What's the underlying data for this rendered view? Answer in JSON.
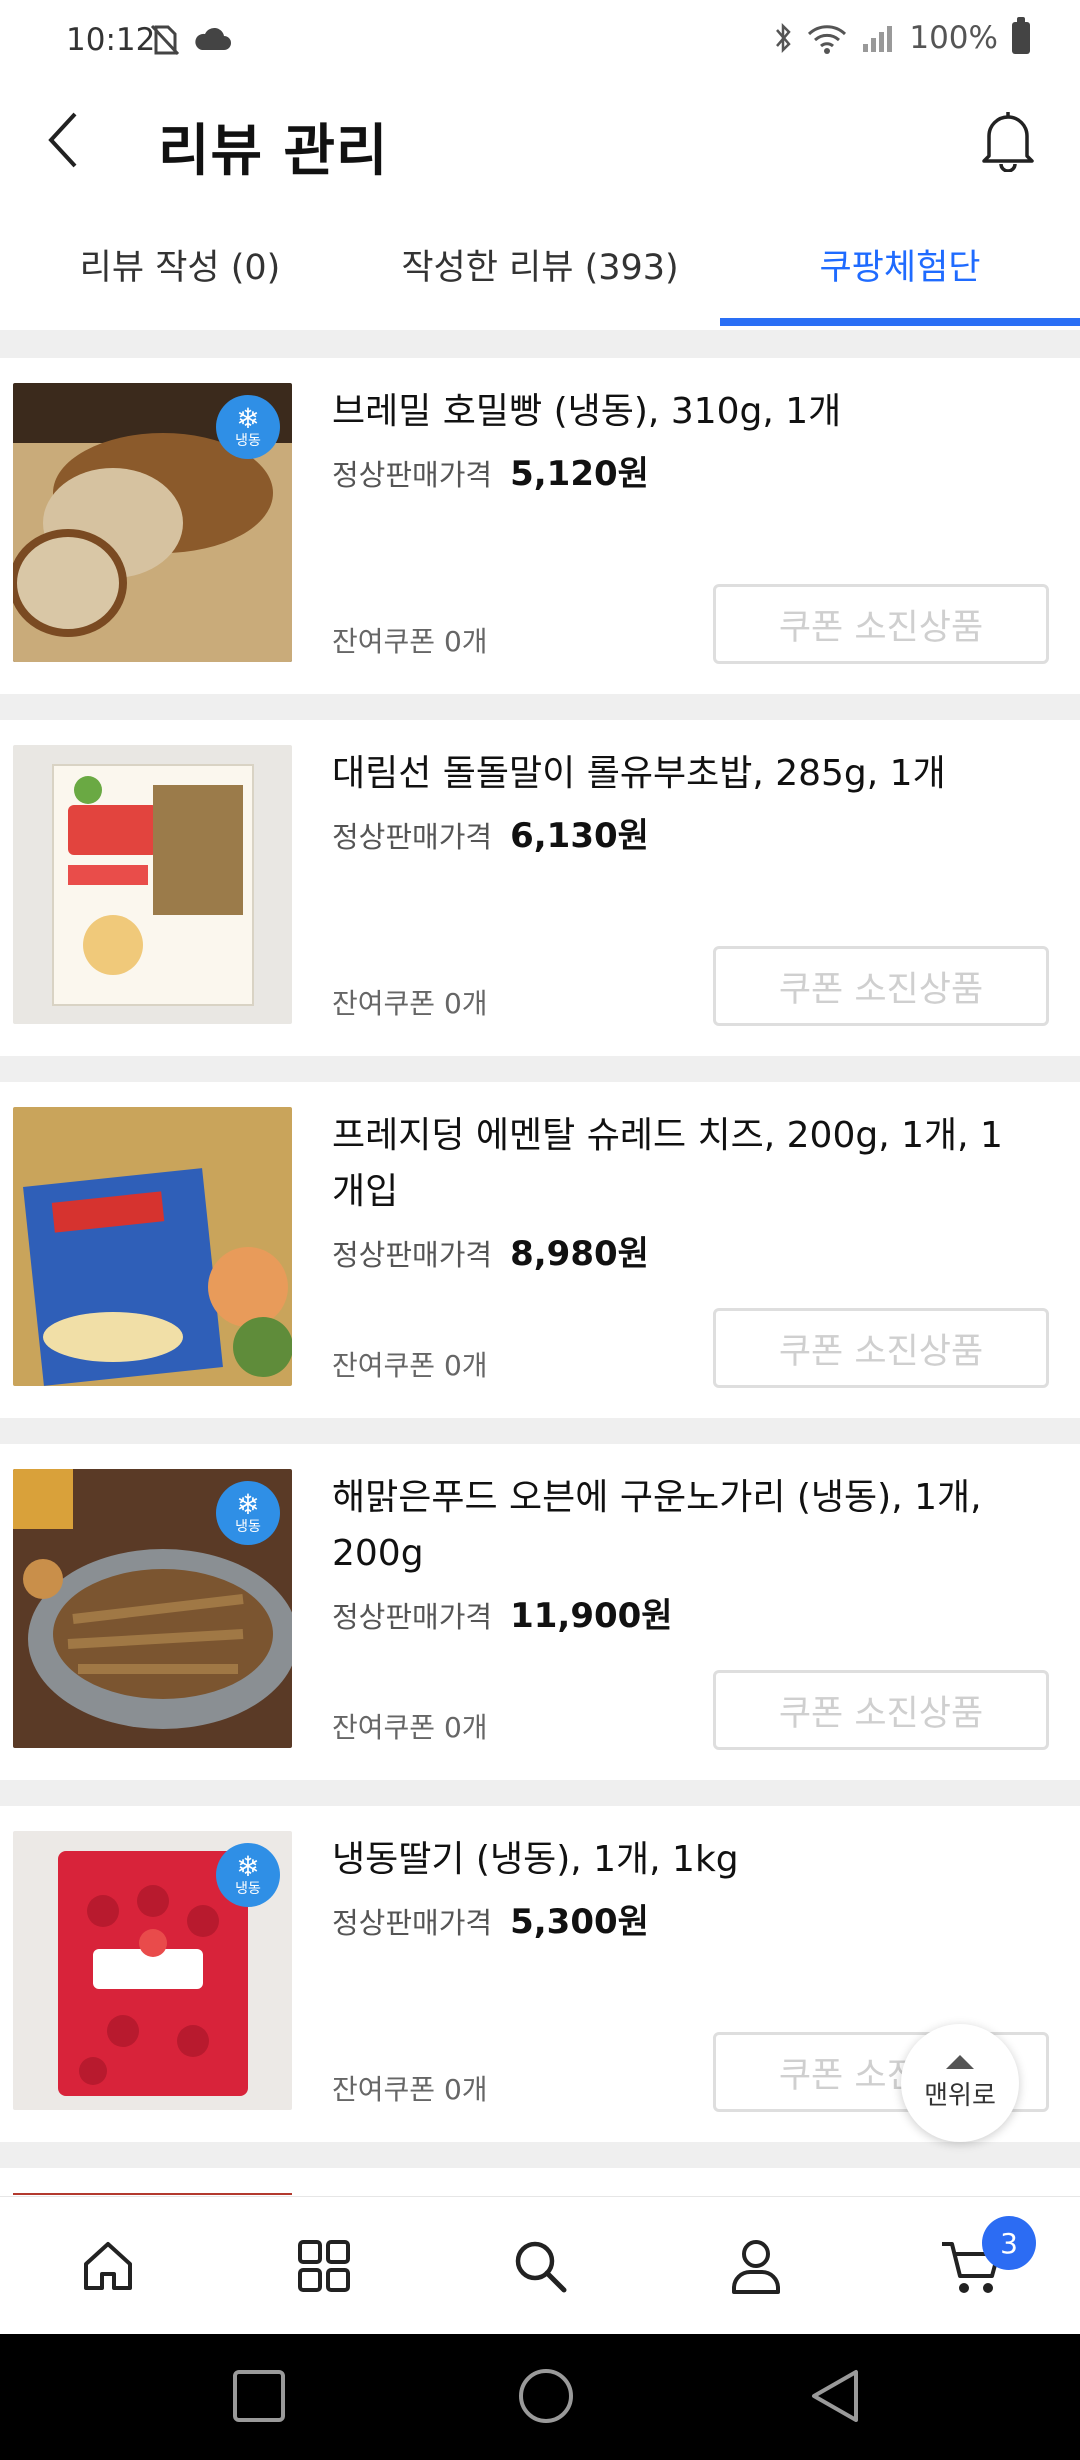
{
  "status_bar": {
    "time": "10:12",
    "battery": "100%",
    "left_icons": [
      "no-sim-icon",
      "cloud-icon"
    ],
    "right_icons": [
      "bluetooth-icon",
      "wifi-icon",
      "signal-icon",
      "battery-icon"
    ]
  },
  "header": {
    "title": "리뷰 관리",
    "back_icon": "chevron-left-icon",
    "bell_icon": "bell-icon"
  },
  "tabs": [
    {
      "label": "리뷰 작성 (0)",
      "active": false
    },
    {
      "label": "작성한 리뷰 (393)",
      "active": false
    },
    {
      "label": "쿠팡체험단",
      "active": true
    }
  ],
  "labels": {
    "price_label": "정상판매가격",
    "soldout_button": "쿠폰 소진상품",
    "frozen_badge": "냉동"
  },
  "items": [
    {
      "title": "브레밀 호밀빵 (냉동), 310g, 1개",
      "price": "5,120원",
      "remaining": "잔여쿠폰 0개",
      "frozen": true,
      "image": "rye-bread"
    },
    {
      "title": "대림선 돌돌말이 롤유부초밥, 285g, 1개",
      "price": "6,130원",
      "remaining": "잔여쿠폰 0개",
      "frozen": false,
      "image": "rolled-inari-pack"
    },
    {
      "title": "프레지덩 에멘탈 슈레드 치즈, 200g, 1개, 1개입",
      "price": "8,980원",
      "remaining": "잔여쿠폰 0개",
      "frozen": false,
      "image": "emmental-cheese-pack"
    },
    {
      "title": "해맑은푸드 오븐에 구운노가리 (냉동), 1개, 200g",
      "price": "11,900원",
      "remaining": "잔여쿠폰 0개",
      "frozen": true,
      "image": "dried-pollock"
    },
    {
      "title": "냉동딸기 (냉동), 1개, 1kg",
      "price": "5,300원",
      "remaining": "잔여쿠폰 0개",
      "frozen": true,
      "image": "frozen-strawberry-bag"
    }
  ],
  "scroll_top": {
    "label": "맨위로"
  },
  "bottom_nav": {
    "items": [
      "home-icon",
      "grid-icon",
      "search-icon",
      "user-icon",
      "cart-icon"
    ],
    "cart_count": "3"
  },
  "colors": {
    "accent": "#2a6ff5",
    "frozen_badge": "#2f8fe6",
    "disabled_text": "#cfcfcf"
  }
}
